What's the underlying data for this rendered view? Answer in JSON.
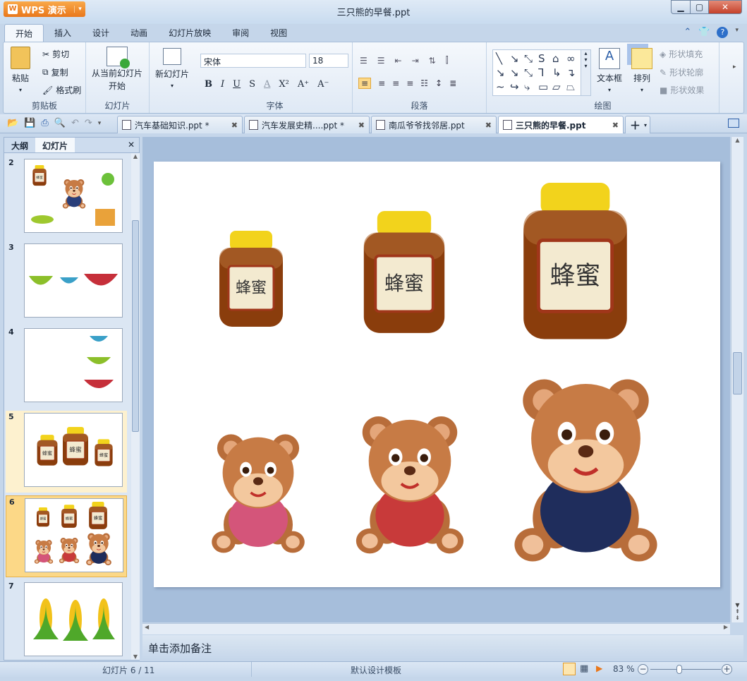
{
  "app": {
    "name": "WPS 演示",
    "title": "三只熊的早餐.ppt"
  },
  "menu_tabs": [
    "开始",
    "插入",
    "设计",
    "动画",
    "幻灯片放映",
    "审阅",
    "视图"
  ],
  "ribbon": {
    "clipboard": {
      "paste": "粘贴",
      "cut": "剪切",
      "copy": "复制",
      "format_painter": "格式刷",
      "label": "剪贴板"
    },
    "slides": {
      "from_current": "从当前幻灯片",
      "from_current2": "开始",
      "new_slide": "新幻灯片",
      "label": "幻灯片"
    },
    "font": {
      "name": "宋体",
      "size": "18",
      "bold": "B",
      "italic": "I",
      "underline": "U",
      "strike": "S",
      "color": "A",
      "superscript": "X²",
      "grow": "A⁺",
      "shrink": "A⁻",
      "label": "字体"
    },
    "paragraph": {
      "label": "段落"
    },
    "drawing": {
      "textbox": "文本框",
      "arrange": "排列",
      "shape_fill": "形状填充",
      "shape_outline": "形状轮廓",
      "shape_effect": "形状效果",
      "label": "绘图"
    }
  },
  "doc_tabs": [
    {
      "label": "汽车基础知识.ppt *"
    },
    {
      "label": "汽车发展史精....ppt *"
    },
    {
      "label": "南瓜爷爷找邻居.ppt"
    },
    {
      "label": "三只熊的早餐.ppt"
    }
  ],
  "left_panel": {
    "tabs": [
      "大纲",
      "幻灯片"
    ],
    "slide_numbers": [
      "2",
      "3",
      "4",
      "5",
      "6",
      "7"
    ],
    "selected": "6"
  },
  "notes_placeholder": "单击添加备注",
  "status": {
    "slide_indicator": "幻灯片 6 / 11",
    "template": "默认设计模板",
    "zoom": "83 %",
    "zoom_percent": 83
  },
  "colors": {
    "accent": "#e9771a",
    "selection": "#fcd887",
    "honey": "#8a3d0c",
    "lid": "#f2d31c",
    "bear": "#c77b45"
  }
}
